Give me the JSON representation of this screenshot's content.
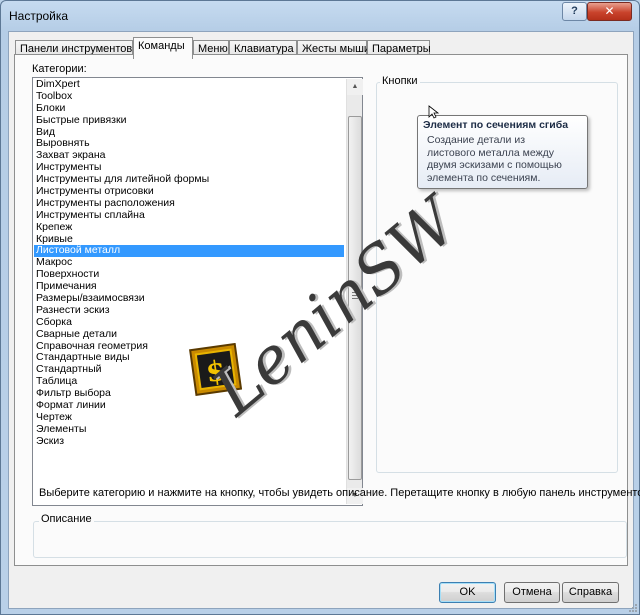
{
  "window": {
    "title": "Настройка",
    "help_label": "?",
    "close_label": "✕"
  },
  "tabs": [
    {
      "label": "Панели инструментов",
      "active": false
    },
    {
      "label": "Команды",
      "active": true
    },
    {
      "label": "Меню",
      "active": false
    },
    {
      "label": "Клавиатура",
      "active": false
    },
    {
      "label": "Жесты мыши",
      "active": false
    },
    {
      "label": "Параметры",
      "active": false
    }
  ],
  "categories": {
    "label": "Категории:",
    "selected_index": 14,
    "items": [
      "DimXpert",
      "Toolbox",
      "Блоки",
      "Быстрые привязки",
      "Вид",
      "Выровнять",
      "Захват экрана",
      "Инструменты",
      "Инструменты для литейной формы",
      "Инструменты отрисовки",
      "Инструменты расположения",
      "Инструменты сплайна",
      "Крепеж",
      "Кривые",
      "Листовой металл",
      "Макрос",
      "Поверхности",
      "Примечания",
      "Размеры/взаимосвязи",
      "Разнести эскиз",
      "Сборка",
      "Сварные детали",
      "Справочная геометрия",
      "Стандартные виды",
      "Стандартный",
      "Таблица",
      "Фильтр выбора",
      "Формат линии",
      "Чертеж",
      "Элементы",
      "Эскиз"
    ]
  },
  "buttons_group": {
    "label": "Кнопки",
    "icons": [
      "base-flange-icon",
      "convert-to-sheet-metal-icon",
      "lofted-bend-icon",
      "edge-flange-icon",
      "miter-flange-icon",
      "hem-icon",
      "jog-icon",
      "sketched-bend-icon",
      "cross-break-icon",
      "closed-corner-icon",
      "welded-corner-icon",
      "break-corner-icon",
      "forming-tool-icon",
      "unfold-icon",
      "fold-icon",
      "flatten-icon",
      "no-bends-icon",
      "rip-icon",
      "insert-bends-icon",
      "vent-icon",
      "sheet-metal-gusset-icon"
    ]
  },
  "tooltip": {
    "title": "Элемент по сечениям сгиба",
    "lines": [
      "Создание детали из",
      "листового металла между",
      "двумя эскизами с помощью",
      "элемента по сечениям."
    ]
  },
  "watermark": {
    "text": "LeninSW"
  },
  "hint_text": "Выберите категорию и нажмите на кнопку, чтобы увидеть описание. Перетащите кнопку в любую панель инструментов.",
  "description": {
    "label": "Описание",
    "value": ""
  },
  "footer": {
    "ok": "OK",
    "cancel": "Отмена",
    "help": "Справка"
  },
  "colors": {
    "selection": "#3399ff",
    "close_button": "#c9432c",
    "titlebar": "#b9d0e8"
  }
}
